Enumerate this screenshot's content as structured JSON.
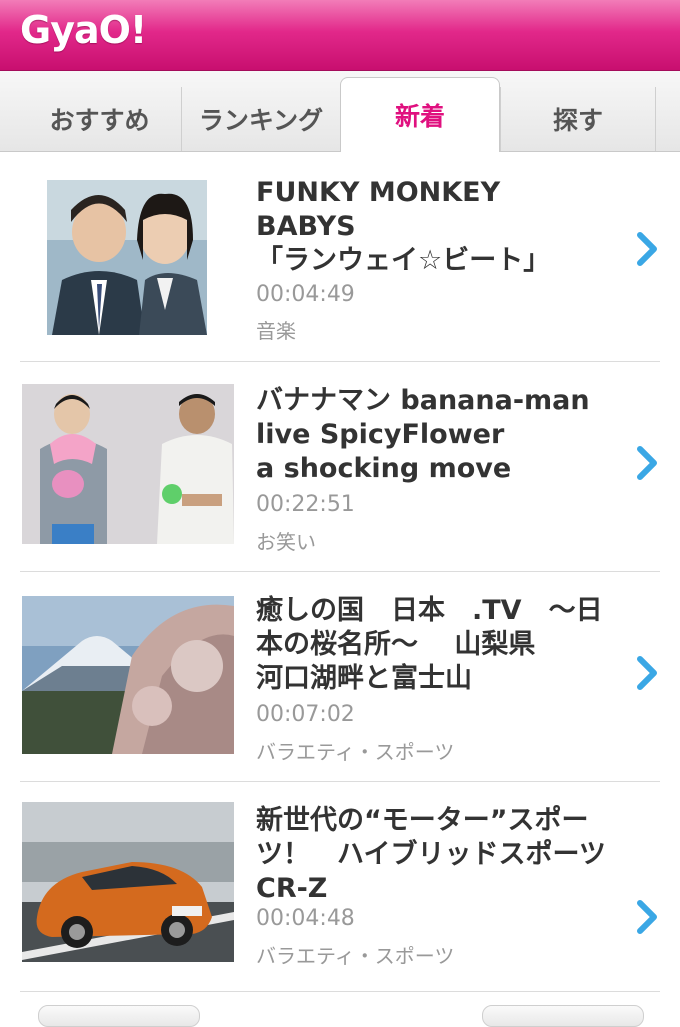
{
  "app": {
    "logo": "GyaO!"
  },
  "tabs": [
    {
      "label": "おすすめ"
    },
    {
      "label": "ランキング"
    },
    {
      "label": "新着"
    },
    {
      "label": "探す"
    }
  ],
  "items": [
    {
      "title_lines": [
        "FUNKY MONKEY",
        "BABYS",
        "「ランウェイ☆ビート」"
      ],
      "duration": "00:04:49",
      "category": "音楽"
    },
    {
      "title_lines": [
        "バナナマン banana-man",
        "live SpicyFlower",
        "a shocking move"
      ],
      "duration": "00:22:51",
      "category": "お笑い"
    },
    {
      "title_lines": [
        "癒しの国　日本　.TV　～日",
        "本の桜名所～　 山梨県",
        "河口湖畔と富士山"
      ],
      "duration": "00:07:02",
      "category": "バラエティ・スポーツ"
    },
    {
      "title_lines": [
        "新世代の“モーター”スポー",
        "ツ！　ハイブリッドスポーツ",
        "CR-Z"
      ],
      "duration": "00:04:48",
      "category": "バラエティ・スポーツ"
    }
  ],
  "colors": {
    "brand": "#e0107f",
    "chevron": "#3aa7e5"
  },
  "icons": {
    "chevron": "chevron-right-icon"
  }
}
